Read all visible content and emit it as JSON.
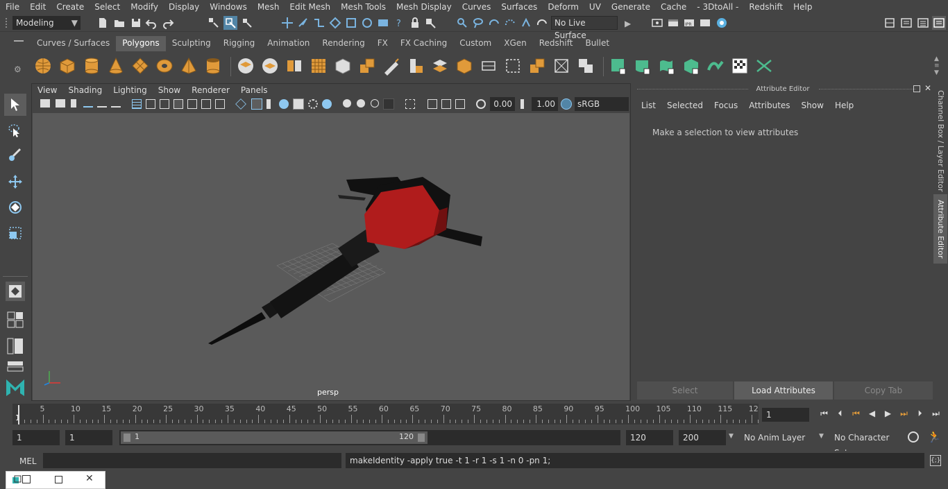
{
  "menubar": {
    "items": [
      "File",
      "Edit",
      "Create",
      "Select",
      "Modify",
      "Display",
      "Windows",
      "Mesh",
      "Edit Mesh",
      "Mesh Tools",
      "Mesh Display",
      "Curves",
      "Surfaces",
      "Deform",
      "UV",
      "Generate",
      "Cache",
      "- 3DtoAll -",
      "Redshift",
      "Help"
    ]
  },
  "status": {
    "workspace": "Modeling",
    "live_surface": "No Live Surface"
  },
  "shelf": {
    "tabs": [
      "Curves / Surfaces",
      "Polygons",
      "Sculpting",
      "Rigging",
      "Animation",
      "Rendering",
      "FX",
      "FX Caching",
      "Custom",
      "XGen",
      "Redshift",
      "Bullet"
    ],
    "active_tab": "Polygons"
  },
  "viewport": {
    "menu": [
      "View",
      "Shading",
      "Lighting",
      "Show",
      "Renderer",
      "Panels"
    ],
    "exposure": "0.00",
    "gamma": "1.00",
    "colorspace": "sRGB gamma",
    "camera": "persp"
  },
  "attribute_editor": {
    "title": "Attribute Editor",
    "menu": [
      "List",
      "Selected",
      "Focus",
      "Attributes",
      "Show",
      "Help"
    ],
    "message": "Make a selection to view attributes",
    "buttons": {
      "select": "Select",
      "load": "Load Attributes",
      "copy": "Copy Tab"
    }
  },
  "side_tabs": {
    "channel_box": "Channel Box / Layer Editor",
    "attribute_editor": "Attribute Editor"
  },
  "timeline": {
    "ticks": [
      "5",
      "10",
      "15",
      "20",
      "25",
      "30",
      "35",
      "40",
      "45",
      "50",
      "55",
      "60",
      "65",
      "70",
      "75",
      "80",
      "85",
      "90",
      "95",
      "100",
      "105",
      "110",
      "115",
      "12"
    ],
    "start_label": "1",
    "current_frame": "1"
  },
  "range": {
    "start": "1",
    "playback_start": "1",
    "slider_start": "1",
    "slider_end": "120",
    "playback_end": "120",
    "end": "200",
    "anim_layer": "No Anim Layer",
    "character_set": "No Character Set"
  },
  "command": {
    "mode": "MEL",
    "output": "makeIdentity -apply true -t 1 -r 1 -s 1 -n 0 -pn 1;"
  },
  "colors": {
    "accent": "#5285a6",
    "mesh_red": "#b01c1c",
    "mesh_black": "#111111",
    "shelf_orange": "#e09a3a",
    "shelf_green": "#4dbb8e"
  }
}
